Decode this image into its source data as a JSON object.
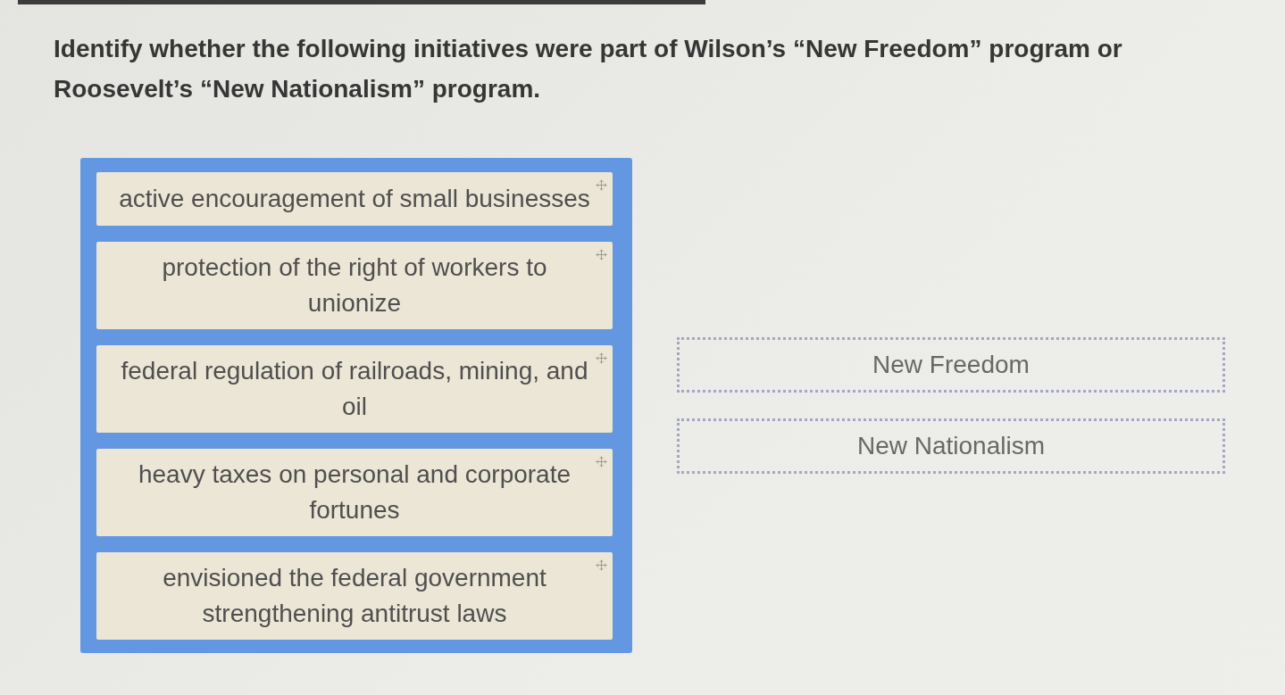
{
  "question": "Identify whether the following initiatives were part of Wilson’s “New Freedom” program or Roosevelt’s “New Nationalism” program.",
  "items": [
    "active encouragement of small businesses",
    "protection of the right of workers to unionize",
    "federal regulation of railroads, mining, and oil",
    "heavy taxes on personal and corporate fortunes",
    "envisioned the federal government strengthening antitrust laws"
  ],
  "targets": [
    "New Freedom",
    "New Nationalism"
  ]
}
